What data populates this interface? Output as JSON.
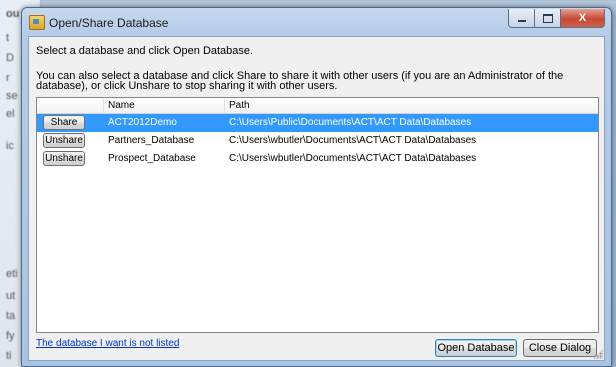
{
  "window": {
    "title": "Open/Share Database"
  },
  "instructions": {
    "line1": "Select a database and click Open Database.",
    "line2": "You can also select a database and click Share to share it with other users (if you are an Administrator of the database), or click Unshare to stop sharing it with other users."
  },
  "grid": {
    "columns": {
      "action": "",
      "name": "Name",
      "path": "Path"
    },
    "rows": [
      {
        "action": "Share",
        "name": "ACT2012Demo",
        "path": "C:\\Users\\Public\\Documents\\ACT\\ACT Data\\Databases",
        "selected": true
      },
      {
        "action": "Unshare",
        "name": "Partners_Database",
        "path": "C:\\Users\\wbutler\\Documents\\ACT\\ACT Data\\Databases",
        "selected": false
      },
      {
        "action": "Unshare",
        "name": "Prospect_Database",
        "path": "C:\\Users\\wbutler\\Documents\\ACT\\ACT Data\\Databases",
        "selected": false
      }
    ]
  },
  "footer": {
    "not_listed_link": "The database I want is not listed",
    "open_button": "Open Database",
    "close_button": "Close Dialog"
  },
  "caption_buttons": {
    "close_glyph": "X"
  },
  "background": {
    "glyphs": [
      "ou",
      "t",
      "D",
      "r",
      "se",
      "el",
      "ic",
      "eti",
      "ut",
      "ta",
      "fy",
      "ti"
    ]
  },
  "colors": {
    "selection": "#3399ff",
    "link": "#0033cc",
    "titlebar": "#b4cbe6"
  }
}
